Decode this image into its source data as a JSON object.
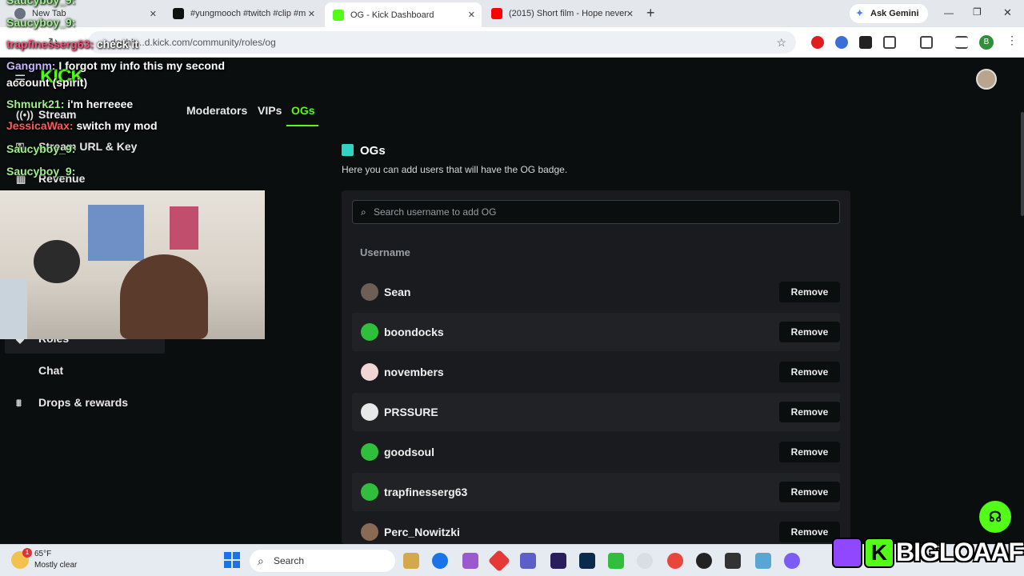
{
  "browser": {
    "tabs": [
      {
        "label": "New Tab",
        "active": false,
        "favicon_color": "#6b7280"
      },
      {
        "label": "#yungmooch #twitch #clip #m",
        "active": false,
        "favicon_color": "#111111"
      },
      {
        "label": "OG - Kick Dashboard",
        "active": true,
        "favicon_color": "#53fc18"
      },
      {
        "label": "(2015) Short film - Hope never",
        "active": false,
        "favicon_color": "#ff0000"
      }
    ],
    "new_tab_label": "+",
    "ask_gemini_label": "Ask Gemini",
    "url": "dashb...d.kick.com/community/roles/og",
    "profile_initial": "B"
  },
  "kick": {
    "logo_text": "KICK",
    "role_tabs": [
      {
        "label": "Moderators",
        "active": false
      },
      {
        "label": "VIPs",
        "active": false
      },
      {
        "label": "OGs",
        "active": true
      }
    ],
    "sidebar": [
      {
        "label": "Stream",
        "icon": "broadcast-icon"
      },
      {
        "label": "Stream URL & Key",
        "icon": "key-icon"
      },
      {
        "label": "Revenue",
        "icon": "bank-icon"
      },
      {
        "label": "Roles",
        "icon": "roles-icon"
      },
      {
        "label": "Chat",
        "icon": "chat-icon"
      },
      {
        "label": "Drops & rewards",
        "icon": "drops-icon"
      }
    ],
    "section_title": "OGs",
    "section_desc": "Here you can add users that will have the OG badge.",
    "search_placeholder": "Search username to add OG",
    "column_header": "Username",
    "remove_label": "Remove",
    "users": [
      {
        "name": "Sean",
        "avatar_color": "#6d5f55"
      },
      {
        "name": "boondocks",
        "avatar_color": "#2fbf3c"
      },
      {
        "name": "novembers",
        "avatar_color": "#f2d6d6"
      },
      {
        "name": "PRSSURE",
        "avatar_color": "#e8e8e8"
      },
      {
        "name": "goodsoul",
        "avatar_color": "#2fbf3c"
      },
      {
        "name": "trapfinesserg63",
        "avatar_color": "#2fbf3c"
      },
      {
        "name": "Perc_Nowitzki",
        "avatar_color": "#8a6a55"
      }
    ]
  },
  "overlay": {
    "chat": [
      {
        "user": "Saucyboy_9:",
        "message": "",
        "color": "#9ef08c"
      },
      {
        "user": "Saucyboy_9:",
        "message": "",
        "color": "#9ef08c"
      },
      {
        "user": "trapfinesserg63:",
        "message": "check it",
        "color": "#ff4f7a"
      },
      {
        "user": "Gangnm:",
        "message": "I forgot my info this my second",
        "color": "#c8b6ff"
      },
      {
        "user": "",
        "message": "account (spirit)",
        "color": "#ffffff"
      },
      {
        "user": "Shmurk21:",
        "message": "i'm herreeee",
        "color": "#9ef08c"
      },
      {
        "user": "JessicaWax:",
        "message": "switch my mod",
        "color": "#ff5a5a"
      },
      {
        "user": "Saucyboy_9:",
        "message": "",
        "color": "#9ef08c"
      },
      {
        "user": "Saucyboy_9:",
        "message": "",
        "color": "#9ef08c"
      }
    ],
    "watermark": "BIGLOAAF"
  },
  "taskbar": {
    "weather_temp": "65°F",
    "weather_desc": "Mostly clear",
    "weather_badge": "1",
    "search_label": "Search"
  }
}
